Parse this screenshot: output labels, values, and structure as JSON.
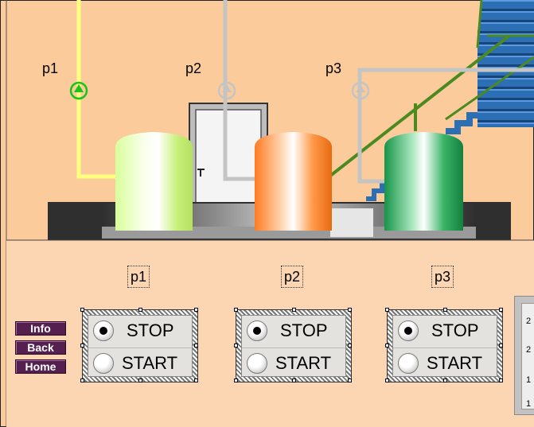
{
  "pumps": [
    {
      "label": "p1"
    },
    {
      "label": "p2"
    },
    {
      "label": "p3"
    }
  ],
  "nav": {
    "info_label": "Info",
    "back_label": "Back",
    "home_label": "Home"
  },
  "controls": [
    {
      "title": "p1",
      "stop_label": "STOP",
      "start_label": "START",
      "selected": "STOP"
    },
    {
      "title": "p2",
      "stop_label": "STOP",
      "start_label": "START",
      "selected": "STOP"
    },
    {
      "title": "p3",
      "stop_label": "STOP",
      "start_label": "START",
      "selected": "STOP"
    }
  ],
  "side_panel": {
    "values": [
      "2",
      "2",
      "1",
      "1"
    ]
  },
  "colors": {
    "background": "#fbcb9c",
    "lower_panel": "#fcd6b2",
    "pipe_active": "#ffff80",
    "pipe_inactive": "#c4c4c4",
    "pump_on": "#19c419",
    "tank1": "#d6ff90",
    "tank2": "#ff8a3a",
    "tank3": "#2ea55a",
    "nav_button": "#55204f"
  },
  "icons": {
    "pump_symbol": "pump-icon",
    "radio": "radio-button-icon"
  }
}
